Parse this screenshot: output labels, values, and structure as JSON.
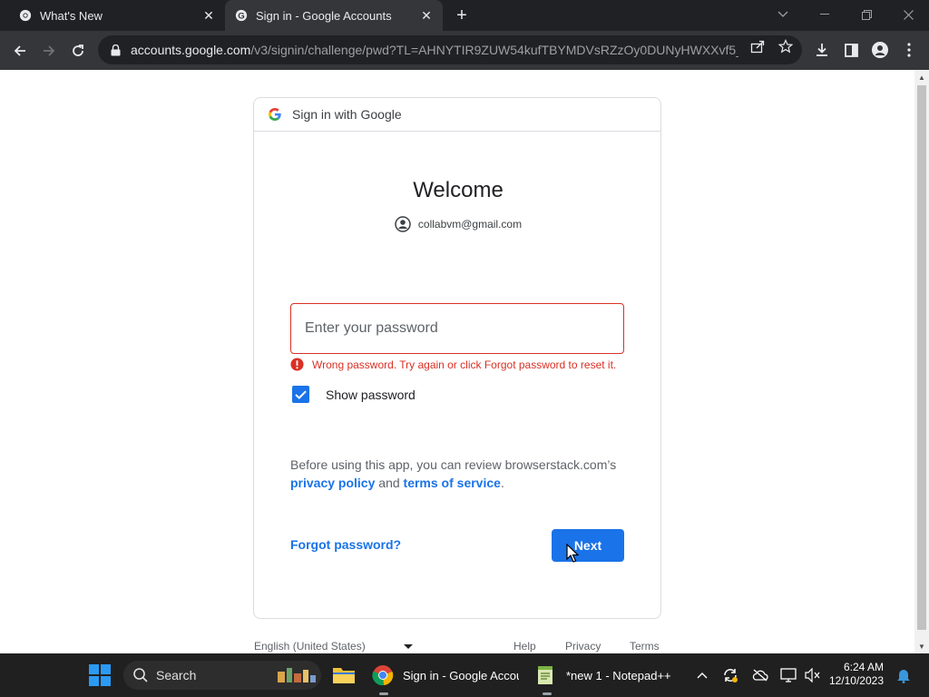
{
  "browser": {
    "tabs": [
      {
        "title": "What's New",
        "active": false
      },
      {
        "title": "Sign in - Google Accounts",
        "active": true
      }
    ],
    "url_host": "accounts.google.com",
    "url_path": "/v3/signin/challenge/pwd?TL=AHNYTIR9ZUW54kufTBYMDVsRZzOy0DUNyHWXXvf5_..."
  },
  "signin": {
    "header": "Sign in with Google",
    "welcome": "Welcome",
    "account_email": "collabvm@gmail.com",
    "password_placeholder": "Enter your password",
    "password_value": "",
    "error_text": "Wrong password. Try again or click Forgot password to reset it.",
    "show_password_label": "Show password",
    "show_password_checked": true,
    "policy_prefix": "Before using this app, you can review browserstack.com’s",
    "privacy_link": "privacy policy",
    "policy_and": " and ",
    "terms_link": "terms of service",
    "policy_suffix": ".",
    "forgot_label": "Forgot password?",
    "next_label": "Next"
  },
  "footer": {
    "language": "English (United States)",
    "help": "Help",
    "privacy": "Privacy",
    "terms": "Terms"
  },
  "taskbar": {
    "search_label": "Search",
    "apps": [
      {
        "label": "Sign in - Google Accour",
        "icon": "chrome-icon"
      },
      {
        "label": "*new 1 - Notepad++",
        "icon": "notepadpp-icon"
      }
    ],
    "time": "6:24 AM",
    "date": "12/10/2023"
  },
  "colors": {
    "accent": "#1a73e8",
    "error": "#d93025",
    "taskbar": "#202020",
    "chrome_dark": "#35363a"
  }
}
